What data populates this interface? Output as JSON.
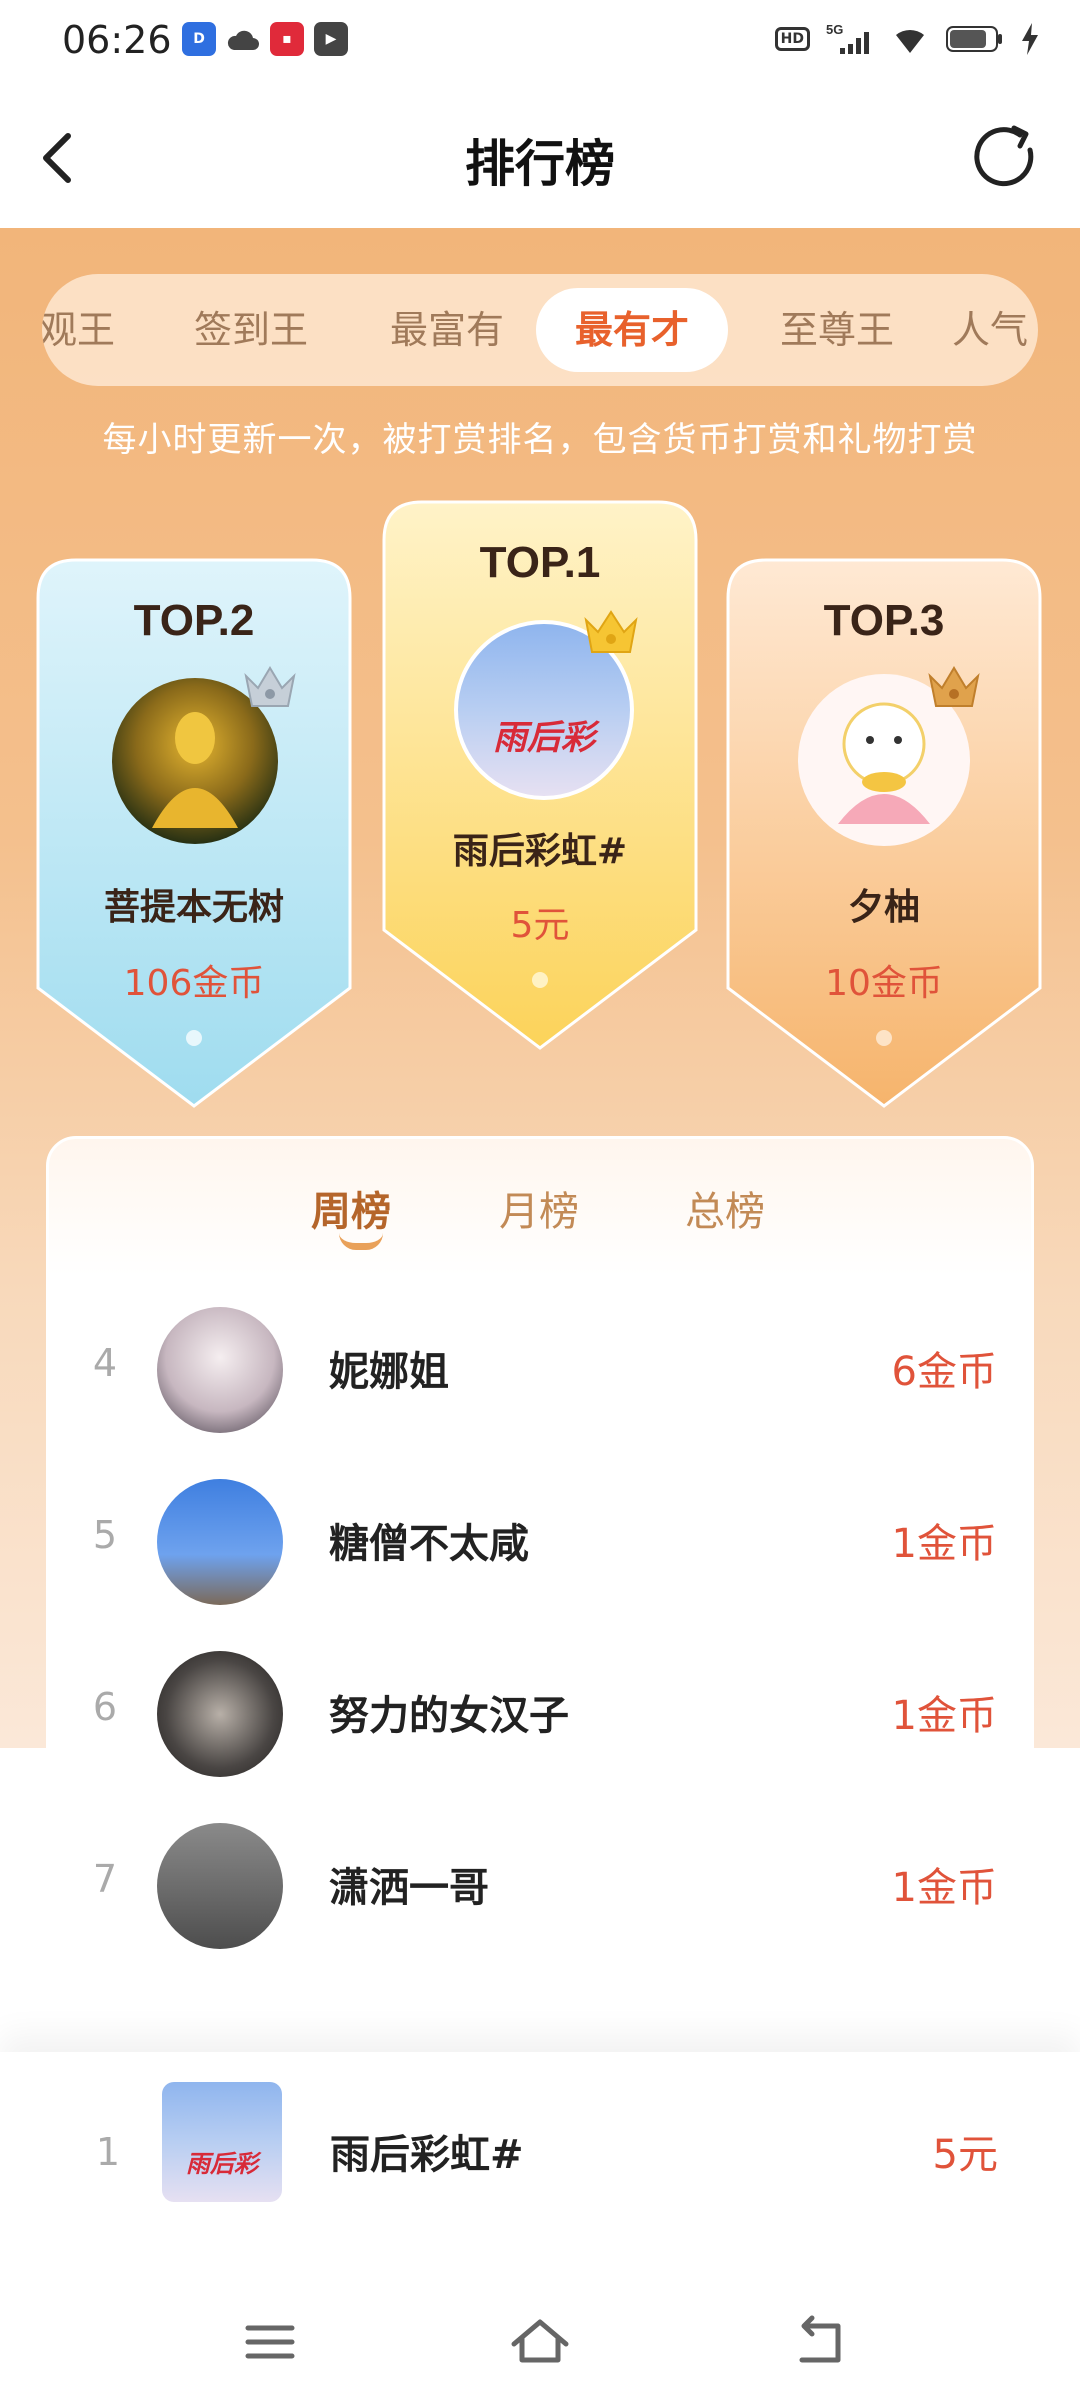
{
  "status_bar": {
    "time": "06:26",
    "network": "5G"
  },
  "header": {
    "title": "排行榜"
  },
  "category_tabs": [
    {
      "label": "观王",
      "active": false
    },
    {
      "label": "签到王",
      "active": false
    },
    {
      "label": "最富有",
      "active": false
    },
    {
      "label": "最有才",
      "active": true
    },
    {
      "label": "至尊王",
      "active": false
    },
    {
      "label": "人气",
      "active": false
    }
  ],
  "notice": "每小时更新一次，被打赏排名，包含货币打赏和礼物打赏",
  "podium": {
    "first": {
      "rank_label": "TOP.1",
      "name": "雨后彩虹#",
      "amount": "5元",
      "avatar_text": "雨后彩"
    },
    "second": {
      "rank_label": "TOP.2",
      "name": "菩提本无树",
      "amount": "106金币"
    },
    "third": {
      "rank_label": "TOP.3",
      "name": "夕柚",
      "amount": "10金币"
    }
  },
  "period_tabs": [
    {
      "label": "周榜",
      "active": true
    },
    {
      "label": "月榜",
      "active": false
    },
    {
      "label": "总榜",
      "active": false
    }
  ],
  "list": [
    {
      "rank": "4",
      "name": "妮娜姐",
      "amount": "6金币"
    },
    {
      "rank": "5",
      "name": "糖僧不太咸",
      "amount": "1金币"
    },
    {
      "rank": "6",
      "name": "努力的女汉子",
      "amount": "1金币"
    },
    {
      "rank": "7",
      "name": "潇洒一哥",
      "amount": "1金币"
    }
  ],
  "my_rank": {
    "rank": "1",
    "name": "雨后彩虹#",
    "amount": "5元",
    "avatar_text": "雨后彩"
  },
  "colors": {
    "accent": "#e8612c",
    "amount": "#e0533a",
    "hero_top": "#f2b57a"
  }
}
